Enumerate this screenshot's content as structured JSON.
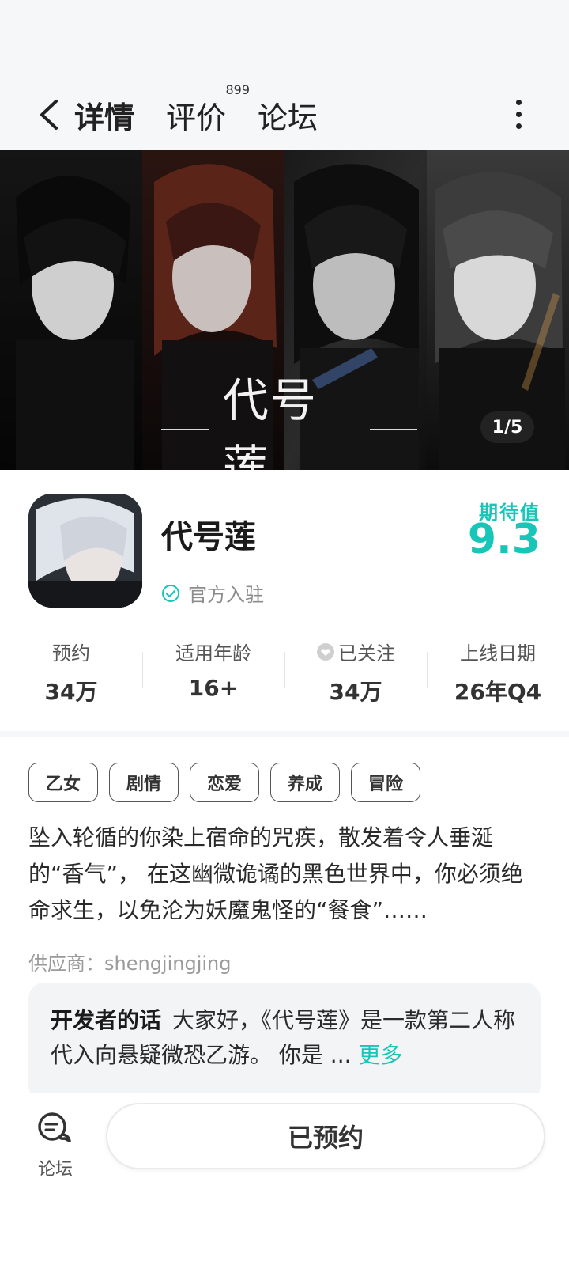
{
  "header": {
    "tabs": [
      {
        "label": "详情"
      },
      {
        "label": "评价",
        "badge": "899"
      },
      {
        "label": "论坛"
      }
    ]
  },
  "banner": {
    "title": "代号莲",
    "counter": "1/5"
  },
  "app": {
    "name": "代号莲",
    "official_label": "官方入驻",
    "expectation_label": "期待值",
    "expectation_value": "9.3"
  },
  "stats": [
    {
      "label": "预约",
      "value": "34万"
    },
    {
      "label": "适用年龄",
      "value": "16+"
    },
    {
      "label": "已关注",
      "value": "34万",
      "icon": "heart-icon"
    },
    {
      "label": "上线日期",
      "value": "26年Q4"
    }
  ],
  "tags": [
    "乙女",
    "剧情",
    "恋爱",
    "养成",
    "冒险"
  ],
  "description": "坠入轮循的你染上宿命的咒疾，散发着令人垂涎的“香气”， 在这幽微诡谲的黑色世界中，你必须绝命求生，以免沦为妖魔鬼怪的“餐食”……",
  "vendor": "供应商：shengjingjing",
  "developer_note": {
    "title": "开发者的话",
    "text": "大家好，《代号莲》是一款第二人称代入向悬疑微恐乙游。 你是 ...",
    "more": "更多"
  },
  "bottom_bar": {
    "forum_label": "论坛",
    "reserve_label": "已预约"
  },
  "colors": {
    "accent": "#18c6b8",
    "background": "#f6f7f9"
  }
}
